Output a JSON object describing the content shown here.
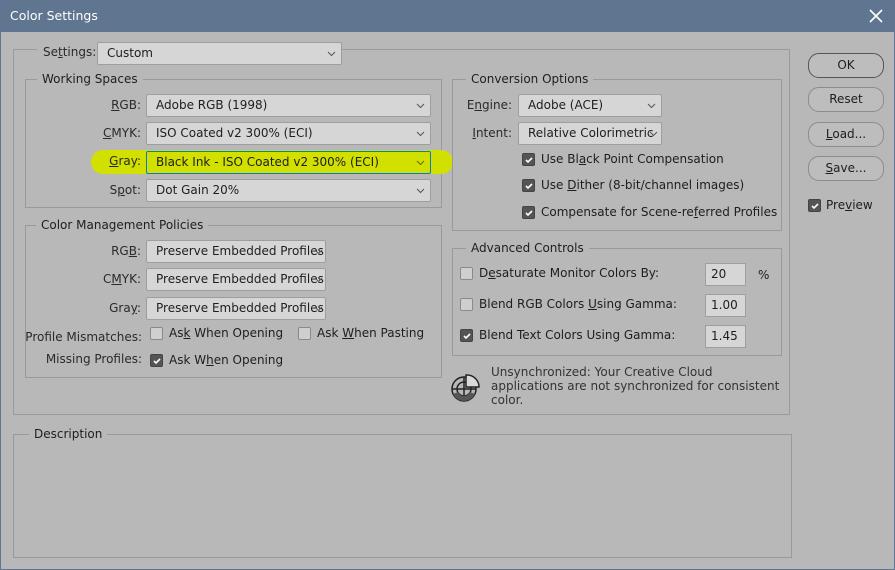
{
  "window": {
    "title": "Color Settings",
    "close_icon": "close-x-icon"
  },
  "settings": {
    "label_pre": "Se",
    "label_u": "t",
    "label_post": "tings:",
    "value": "Custom"
  },
  "working_spaces": {
    "title": "Working Spaces",
    "rgb": {
      "label_u": "R",
      "label_post": "GB:",
      "value": "Adobe RGB (1998)"
    },
    "cmyk": {
      "label_u": "C",
      "label_post": "MYK:",
      "value": "ISO Coated v2 300% (ECI)"
    },
    "gray": {
      "label_u": "G",
      "label_post": "ray:",
      "value": "Black Ink - ISO Coated v2 300% (ECI)",
      "highlight_color": "#d2e000"
    },
    "spot": {
      "label_pre": "S",
      "label_u": "p",
      "label_post": "ot:",
      "value": "Dot Gain 20%"
    }
  },
  "policies": {
    "title": "Color Management Policies",
    "rgb": {
      "label_pre": "RG",
      "label_u": "B",
      "label_post": ":",
      "value": "Preserve Embedded Profiles"
    },
    "cmyk": {
      "label_pre": "C",
      "label_u": "M",
      "label_post": "YK:",
      "value": "Preserve Embedded Profiles"
    },
    "gray": {
      "label_pre": "Gra",
      "label_u": "y",
      "label_post": ":",
      "value": "Preserve Embedded Profiles"
    },
    "profile_mismatches": {
      "label": "Profile Mismatches:",
      "ask_opening": {
        "pre": "As",
        "u": "k",
        "post": " When Opening",
        "checked": false
      },
      "ask_pasting": {
        "pre": "Ask ",
        "u": "W",
        "post": "hen Pasting",
        "checked": false
      }
    },
    "missing_profiles": {
      "label": "Missing Profiles:",
      "ask_opening": {
        "pre": "Ask W",
        "u": "h",
        "post": "en Opening",
        "checked": true
      }
    }
  },
  "conversion": {
    "title": "Conversion Options",
    "engine": {
      "label_pre": "E",
      "label_u": "n",
      "label_post": "gine:",
      "value": "Adobe (ACE)"
    },
    "intent": {
      "label_u": "I",
      "label_post": "ntent:",
      "value": "Relative Colorimetric"
    },
    "black_point": {
      "pre": "Use Bl",
      "u": "a",
      "post": "ck Point Compensation",
      "checked": true
    },
    "dither": {
      "pre": "Use ",
      "u": "D",
      "post": "ither (8-bit/channel images)",
      "checked": true
    },
    "scene_referred": {
      "pre": "Compensate for Scene-re",
      "u": "f",
      "post": "erred Profiles",
      "checked": true
    }
  },
  "advanced": {
    "title": "Advanced Controls",
    "desaturate": {
      "pre": "D",
      "u": "e",
      "post": "saturate Monitor Colors By:",
      "checked": false,
      "value": "20",
      "unit": "%"
    },
    "blend_rgb": {
      "pre": "Blend RGB Colors ",
      "u": "U",
      "post": "sing Gamma:",
      "checked": false,
      "value": "1.00"
    },
    "blend_text": {
      "pre": "Blend Text Colors Using Gamma:",
      "u": "",
      "post": "",
      "checked": true,
      "value": "1.45"
    }
  },
  "sync": {
    "icon": "color-sync-icon",
    "text": "Unsynchronized: Your Creative Cloud applications are not synchronized for consistent color."
  },
  "description": {
    "title": "Description",
    "text": ""
  },
  "buttons": {
    "ok": {
      "label": "OK"
    },
    "reset": {
      "label": "Reset"
    },
    "load": {
      "u": "L",
      "post": "oad..."
    },
    "save": {
      "u": "S",
      "post": "ave..."
    }
  },
  "preview": {
    "pre": "Pre",
    "u": "v",
    "post": "iew",
    "checked": true
  }
}
